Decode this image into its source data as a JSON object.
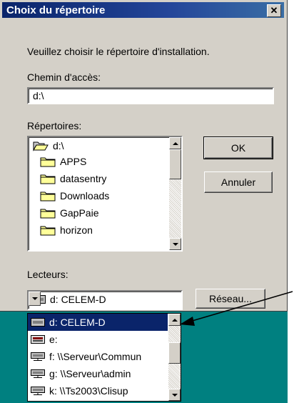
{
  "window": {
    "title": "Choix du répertoire",
    "close_glyph": "✕"
  },
  "prompt": "Veuillez choisir le répertoire d'installation.",
  "path": {
    "label": "Chemin d'accès:",
    "value": "d:\\"
  },
  "directories": {
    "label": "Répertoires:",
    "items": [
      {
        "label": "d:\\",
        "icon": "open-folder-icon"
      },
      {
        "label": "APPS",
        "icon": "folder-icon"
      },
      {
        "label": "datasentry",
        "icon": "folder-icon"
      },
      {
        "label": "Downloads",
        "icon": "folder-icon"
      },
      {
        "label": "GapPaie",
        "icon": "folder-icon"
      },
      {
        "label": "horizon",
        "icon": "folder-icon"
      }
    ]
  },
  "buttons": {
    "ok": "OK",
    "cancel": "Annuler",
    "network": "Réseau..."
  },
  "drives": {
    "label": "Lecteurs:",
    "selected": "d: CELEM-D",
    "items": [
      {
        "label": "d: CELEM-D",
        "icon": "hard-drive-icon",
        "selected": true
      },
      {
        "label": "e:",
        "icon": "removable-drive-icon"
      },
      {
        "label": "f: \\\\Serveur\\Commun",
        "icon": "network-drive-icon"
      },
      {
        "label": "g: \\\\Serveur\\admin",
        "icon": "network-drive-icon"
      },
      {
        "label": "k: \\\\Ts2003\\Clisup",
        "icon": "network-drive-icon"
      }
    ]
  },
  "colors": {
    "title_bar": "#0a246a",
    "dialog_face": "#d4d0c8",
    "selection": "#0a246a",
    "desktop": "#008080"
  }
}
